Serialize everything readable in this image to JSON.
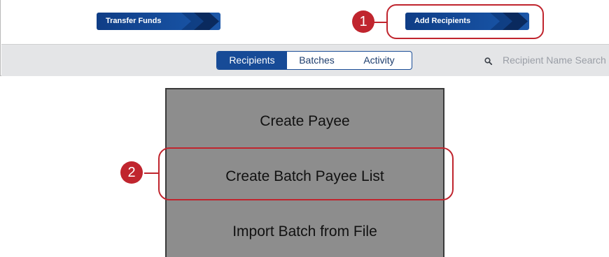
{
  "actions": {
    "transfer_funds": "Transfer Funds",
    "add_recipients": "Add Recipients"
  },
  "callouts": {
    "one": "1",
    "two": "2"
  },
  "tabs": [
    {
      "label": "Recipients",
      "active": true
    },
    {
      "label": "Batches",
      "active": false
    },
    {
      "label": "Activity",
      "active": false
    }
  ],
  "search": {
    "placeholder": "Recipient Name Search",
    "icon": "search-icon"
  },
  "menu": {
    "items": [
      "Create Payee",
      "Create Batch Payee List",
      "Import Batch from File"
    ]
  },
  "colors": {
    "primary": "#174b97",
    "callout": "#c0252e",
    "menu_bg": "#8d8d8d",
    "toolbar_bg": "#e4e5e7"
  }
}
